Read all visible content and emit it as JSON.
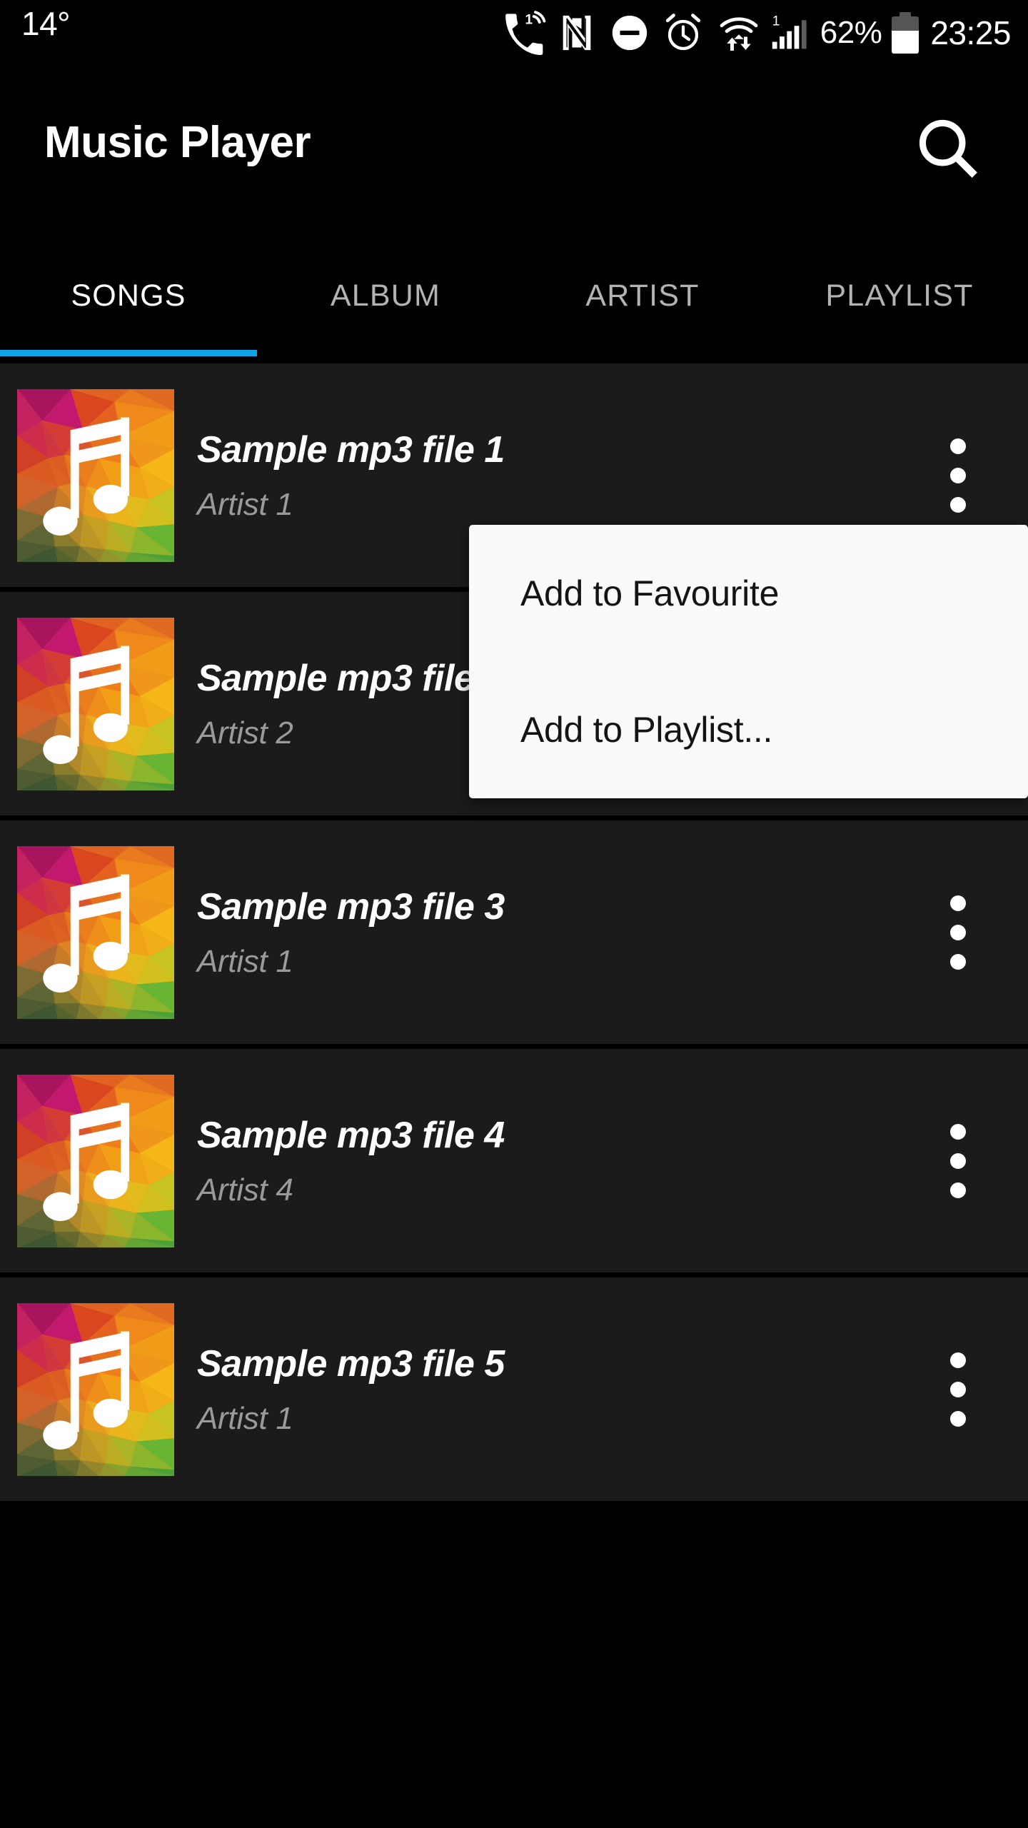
{
  "status_bar": {
    "temperature": "14°",
    "battery_percent": "62%",
    "battery_level": 62,
    "time": "23:25",
    "icons": [
      {
        "name": "missed-call-icon",
        "badge": "1"
      },
      {
        "name": "nfc-icon"
      },
      {
        "name": "do-not-disturb-icon"
      },
      {
        "name": "alarm-clock-icon"
      },
      {
        "name": "wifi-transfer-icon"
      },
      {
        "name": "cellular-signal-icon",
        "badge": "1"
      },
      {
        "name": "battery-icon"
      }
    ]
  },
  "app_bar": {
    "title": "Music Player",
    "search_icon": "search-icon"
  },
  "tabs": {
    "active_index": 0,
    "indicator_color": "#0da5e8",
    "items": [
      {
        "label": "SONGS"
      },
      {
        "label": "ALBUM"
      },
      {
        "label": "ARTIST"
      },
      {
        "label": "PLAYLIST"
      }
    ]
  },
  "songs": [
    {
      "title": "Sample mp3 file 1",
      "artist": "Artist 1",
      "overflow_icon": "more-vertical-icon"
    },
    {
      "title": "Sample mp3 file 2",
      "artist": "Artist 2",
      "overflow_icon": "more-vertical-icon"
    },
    {
      "title": "Sample mp3 file 3",
      "artist": "Artist 1",
      "overflow_icon": "more-vertical-icon"
    },
    {
      "title": "Sample mp3 file 4",
      "artist": "Artist 4",
      "overflow_icon": "more-vertical-icon"
    },
    {
      "title": "Sample mp3 file 5",
      "artist": "Artist 1",
      "overflow_icon": "more-vertical-icon"
    }
  ],
  "popup_menu": {
    "visible": true,
    "background": "#fafafa",
    "items": [
      {
        "label": "Add to Favourite"
      },
      {
        "label": "Add to Playlist..."
      }
    ]
  },
  "theme": {
    "screen_background": "#000000",
    "row_background": "#1b1b1b",
    "title_color": "#ffffff",
    "artist_color": "#9a9a9a",
    "tab_active_color": "#ffffff",
    "tab_inactive_color": "#b3b3b3",
    "accent_color": "#0da5e8",
    "album_art_colors": [
      "#c2186e",
      "#e8532a",
      "#f08a1e",
      "#f5b91d",
      "#a8c22a",
      "#3fa63b"
    ]
  }
}
